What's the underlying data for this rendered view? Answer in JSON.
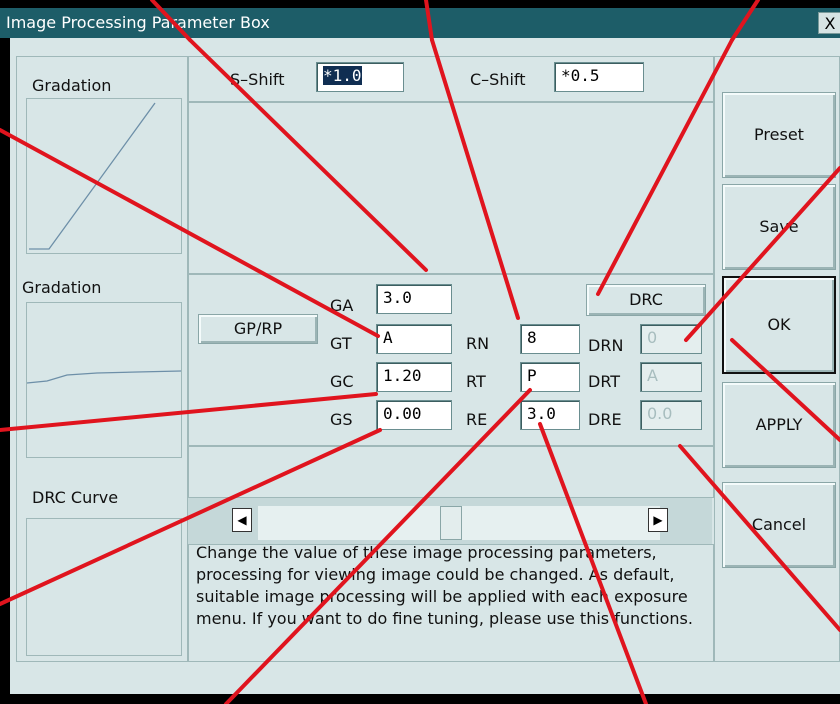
{
  "window": {
    "title": "Image Processing Parameter Box",
    "close_glyph": "X"
  },
  "shift": {
    "s_label": "S–Shift",
    "s_value": "*1.0",
    "c_label": "C–Shift",
    "c_value": "*0.5"
  },
  "left": {
    "gradation1": "Gradation",
    "gradation2": "Gradation",
    "drc_curve": "DRC Curve"
  },
  "params": {
    "mode_button": "GP/RP",
    "ga_label": "GA",
    "ga_value": "3.0",
    "gt_label": "GT",
    "gt_value": "A",
    "gc_label": "GC",
    "gc_value": "1.20",
    "gs_label": "GS",
    "gs_value": "0.00",
    "rn_label": "RN",
    "rn_value": "8",
    "rt_label": "RT",
    "rt_value": "P",
    "re_label": "RE",
    "re_value": "3.0",
    "drc_button": "DRC",
    "drn_label": "DRN",
    "drn_value": "0",
    "drt_label": "DRT",
    "drt_value": "A",
    "dre_label": "DRE",
    "dre_value": "0.0"
  },
  "buttons": {
    "preset": "Preset",
    "save": "Save",
    "ok": "OK",
    "apply": "APPLY",
    "cancel": "Cancel"
  },
  "scrollbar": {
    "left_arrow": "◀",
    "right_arrow": "▶"
  },
  "description": "Change the value of these image processing parameters, processing for viewing image could be changed. As default, suitable image processing will be applied with each exposure menu. If you want to do fine tuning, please use this functions.",
  "colors": {
    "annotation_line": "#e0141e",
    "titlebar": "#1d5d68",
    "panel_bg": "#d8e6e7"
  }
}
